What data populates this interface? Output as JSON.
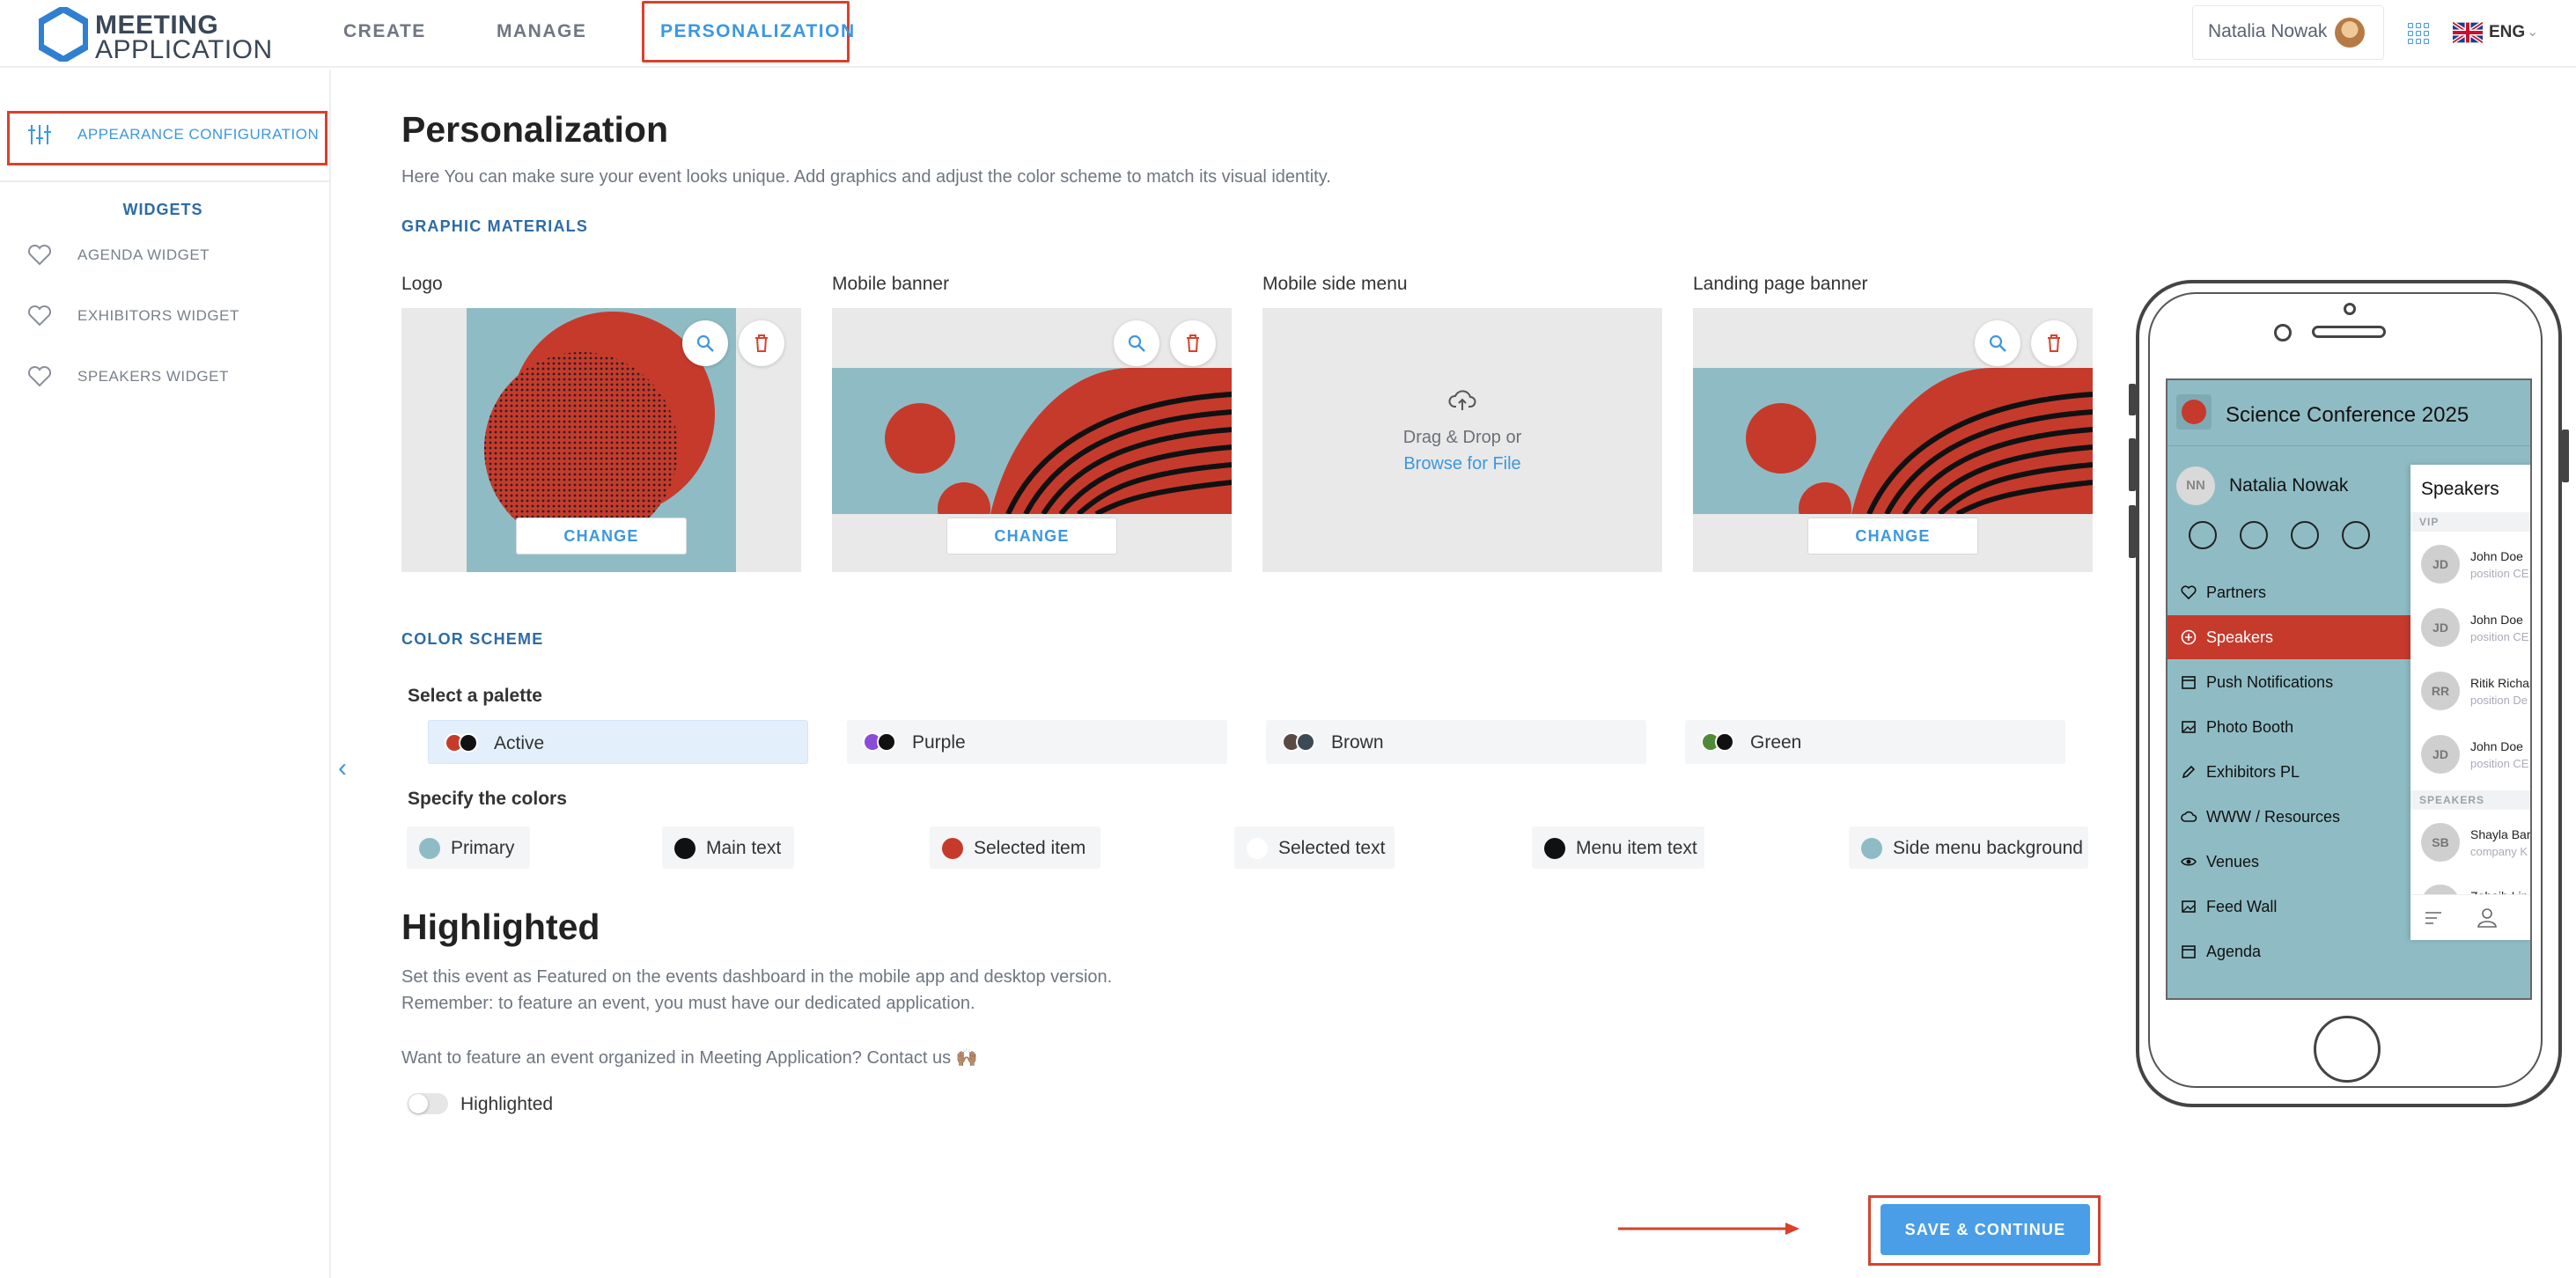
{
  "app": {
    "logo_line1": "MEETING",
    "logo_line2": "APPLICATION"
  },
  "nav": {
    "create": "CREATE",
    "manage": "MANAGE",
    "personalization": "PERSONALIZATION"
  },
  "user": {
    "name": "Natalia Nowak",
    "language": "ENG"
  },
  "sidebar": {
    "appearance": "APPEARANCE CONFIGURATION",
    "widgets_heading": "WIDGETS",
    "items": [
      "AGENDA WIDGET",
      "EXHIBITORS WIDGET",
      "SPEAKERS WIDGET"
    ]
  },
  "page": {
    "title": "Personalization",
    "intro": "Here You can make sure your event looks unique. Add graphics and adjust the color scheme to match its visual identity."
  },
  "graphic_materials": {
    "heading": "GRAPHIC MATERIALS",
    "cards": [
      {
        "label": "Logo",
        "button": "CHANGE"
      },
      {
        "label": "Mobile banner",
        "button": "CHANGE"
      },
      {
        "label": "Mobile side menu",
        "drop_text": "Drag & Drop or",
        "drop_link": "Browse for File"
      },
      {
        "label": "Landing page banner",
        "button": "CHANGE"
      }
    ]
  },
  "color_scheme": {
    "heading": "COLOR SCHEME",
    "palette_title": "Select a palette",
    "palettes": [
      {
        "name": "Active",
        "colors": [
          "#c63a2c",
          "#111111"
        ],
        "active": true
      },
      {
        "name": "Purple",
        "colors": [
          "#8a4bd8",
          "#111111"
        ],
        "active": false
      },
      {
        "name": "Brown",
        "colors": [
          "#5a4a42",
          "#3b4a55"
        ],
        "active": false
      },
      {
        "name": "Green",
        "colors": [
          "#4f8a3a",
          "#111111"
        ],
        "active": false
      }
    ],
    "colors_title": "Specify the colors",
    "colors": [
      {
        "name": "Primary",
        "color": "#8fbcc4"
      },
      {
        "name": "Main text",
        "color": "#111111"
      },
      {
        "name": "Selected item",
        "color": "#c63a2c"
      },
      {
        "name": "Selected text",
        "color": "#ffffff"
      },
      {
        "name": "Menu item text",
        "color": "#111111"
      },
      {
        "name": "Side menu background",
        "color": "#8fbcc4"
      }
    ]
  },
  "highlighted": {
    "title": "Highlighted",
    "line1": "Set this event as Featured on the events dashboard in the mobile app and desktop version.",
    "line2": "Remember: to feature an event, you must have our dedicated application.",
    "line3": "Want to feature an event organized in Meeting Application? Contact us 🙌🏽",
    "toggle_label": "Highlighted",
    "toggle_on": false
  },
  "actions": {
    "save": "SAVE & CONTINUE"
  },
  "preview": {
    "event_title": "Science Conference 2025",
    "user_initials": "NN",
    "user_name": "Natalia Nowak",
    "menu": [
      "Partners",
      "Speakers",
      "Push Notifications",
      "Photo Booth",
      "Exhibitors PL",
      "WWW / Resources",
      "Venues",
      "Feed Wall",
      "Agenda"
    ],
    "selected_menu": "Speakers",
    "panel": {
      "title": "Speakers",
      "band_vip": "VIP",
      "band_speakers": "SPEAKERS",
      "vip": [
        {
          "initials": "JD",
          "name": "John Doe",
          "position": "position CE"
        },
        {
          "initials": "JD",
          "name": "John Doe",
          "position": "position CE"
        },
        {
          "initials": "RR",
          "name": "Ritik Richar",
          "position": "position De"
        },
        {
          "initials": "JD",
          "name": "John Doe",
          "position": "position CE"
        }
      ],
      "speakers": [
        {
          "initials": "SB",
          "name": "Shayla Bar",
          "position": "company K"
        },
        {
          "initials": "ZL",
          "name": "Zohaib Lin",
          "position": ""
        }
      ]
    }
  },
  "colors": {
    "accent": "#3d97e1",
    "annotation": "#d9412b",
    "heading_blue": "#2d6ba6"
  }
}
